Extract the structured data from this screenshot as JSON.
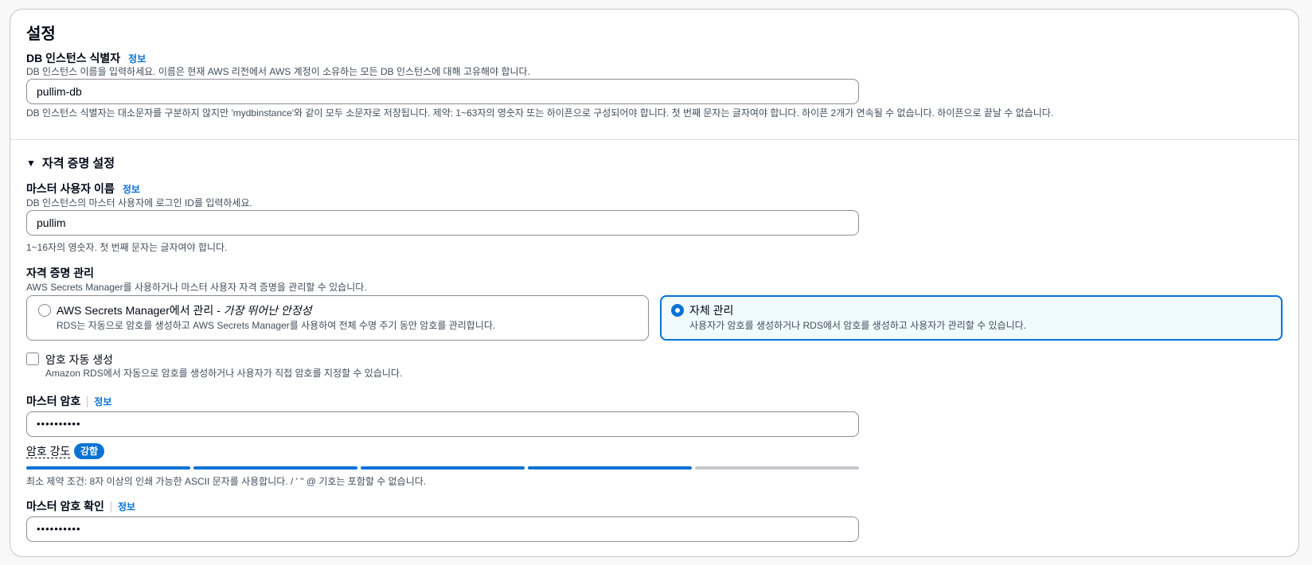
{
  "section": {
    "title": "설정"
  },
  "db_identifier": {
    "label": "DB 인스턴스 식별자",
    "info": "정보",
    "description": "DB 인스턴스 이름을 입력하세요. 이름은 현재 AWS 리전에서 AWS 계정이 소유하는 모든 DB 인스턴스에 대해 고유해야 합니다.",
    "value": "pullim-db",
    "constraint": "DB 인스턴스 식별자는 대소문자를 구분하지 않지만 'mydbinstance'와 같이 모두 소문자로 저장됩니다. 제약: 1~63자의 영숫자 또는 하이픈으로 구성되어야 합니다. 첫 번째 문자는 글자여야 합니다. 하이픈 2개가 연속될 수 없습니다. 하이픈으로 끝날 수 없습니다."
  },
  "credentials": {
    "expand_icon": "caret-down-icon",
    "title": "자격 증명 설정",
    "master_username": {
      "label": "마스터 사용자 이름",
      "info": "정보",
      "description": "DB 인스턴스의 마스터 사용자에 로그인 ID를 입력하세요.",
      "value": "pullim",
      "constraint": "1~16자의 영숫자. 첫 번째 문자는 글자여야 합니다."
    },
    "management": {
      "label": "자격 증명 관리",
      "description": "AWS Secrets Manager를 사용하거나 마스터 사용자 자격 증명을 관리할 수 있습니다.",
      "options": [
        {
          "title": "AWS Secrets Manager에서 관리",
          "emphasis": " - 가장 뛰어난 안정성",
          "description": "RDS는 자동으로 암호를 생성하고 AWS Secrets Manager를 사용하여 전체 수명 주기 동안 암호를 관리합니다.",
          "selected": false
        },
        {
          "title": "자체 관리",
          "emphasis": "",
          "description": "사용자가 암호를 생성하거나 RDS에서 암호를 생성하고 사용자가 관리할 수 있습니다.",
          "selected": true
        }
      ]
    },
    "auto_generate": {
      "label": "암호 자동 생성",
      "description": "Amazon RDS에서 자동으로 암호를 생성하거나 사용자가 직접 암호를 지정할 수 있습니다.",
      "checked": false
    },
    "master_password": {
      "label": "마스터 암호",
      "info": "정보",
      "value": "••••••••••"
    },
    "strength": {
      "label": "암호 강도",
      "badge": "강함",
      "filled_segments": 4,
      "total_segments": 5,
      "colors": {
        "filled": "#0972d3",
        "empty": "#c6c6cd"
      },
      "constraint": "최소 제약 조건: 8자 이상의 인쇄 가능한 ASCII 문자를 사용합니다. / ' \" @ 기호는 포함할 수 없습니다."
    },
    "confirm_password": {
      "label": "마스터 암호 확인",
      "info": "정보",
      "value": "••••••••••"
    }
  }
}
